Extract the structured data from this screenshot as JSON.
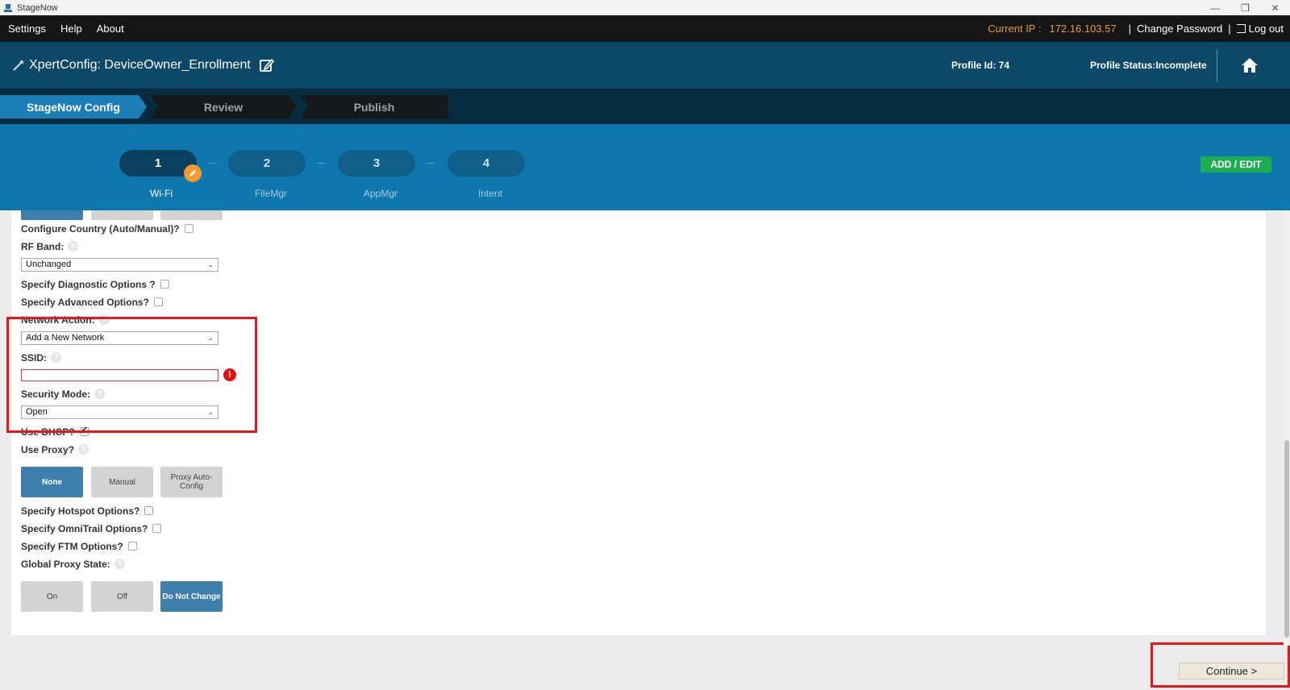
{
  "window": {
    "title": "StageNow",
    "controls": [
      "—",
      "❐",
      "✕"
    ]
  },
  "menubar": {
    "items": [
      "Settings",
      "Help",
      "About"
    ],
    "current_ip_label": "Current IP :",
    "current_ip_value": "172.16.103.57",
    "separator": "|",
    "change_password": "Change Password",
    "logout": "Log out"
  },
  "header": {
    "title": "XpertConfig: DeviceOwner_Enrollment",
    "profile_id": "Profile Id: 74",
    "profile_status": "Profile Status:Incomplete"
  },
  "wizard_tabs": [
    "StageNow Config",
    "Review",
    "Publish"
  ],
  "steps": [
    {
      "number": "1",
      "label": "Wi-Fi"
    },
    {
      "number": "2",
      "label": "FileMgr"
    },
    {
      "number": "3",
      "label": "AppMgr"
    },
    {
      "number": "4",
      "label": "Intent"
    }
  ],
  "add_edit": "ADD / EDIT",
  "form": {
    "configure_country": "Configure Country (Auto/Manual)?",
    "rf_band": "RF Band:",
    "rf_band_value": "Unchanged",
    "diagnostic_options": "Specify Diagnostic Options ?",
    "advanced_options": "Specify Advanced Options?",
    "network_action": "Network Action:",
    "network_action_value": "Add a New Network",
    "ssid": "SSID:",
    "ssid_value": "",
    "ssid_error": "!",
    "security_mode": "Security Mode:",
    "security_mode_value": "Open",
    "use_dhcp": "Use DHCP?",
    "use_dhcp_checked": true,
    "use_proxy": "Use Proxy?",
    "proxy_buttons": [
      "None",
      "Manual",
      "Proxy Auto-Config"
    ],
    "proxy_selected": "None",
    "hotspot_options": "Specify Hotspot Options?",
    "omnitrail_options": "Specify OmniTrail Options?",
    "ftm_options": "Specify FTM Options?",
    "global_proxy_state": "Global Proxy State:",
    "global_proxy_buttons": [
      "On",
      "Off",
      "Do Not Change"
    ],
    "global_proxy_selected": "Do Not Change",
    "help_glyph": "?",
    "chevron": "⌄"
  },
  "continue_button": "Continue  >",
  "colors": {
    "menubar": "#151515",
    "header": "#0c4868",
    "step_band": "#0e77ad",
    "active_tab": "#1b7fb5",
    "selected_button": "#3f7fae",
    "add_edit": "#1eae52",
    "ip_text": "#e0a020",
    "highlight": "#e8171b"
  }
}
